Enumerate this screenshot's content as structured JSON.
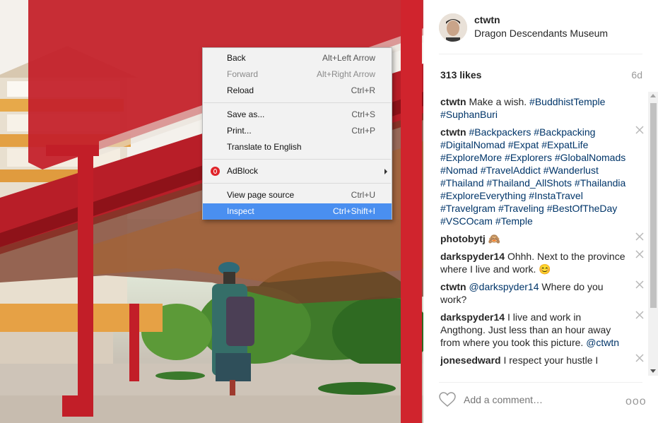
{
  "post": {
    "username": "ctwtn",
    "location": "Dragon Descendants Museum",
    "likes": "313 likes",
    "age": "6d"
  },
  "comments": [
    {
      "user": "ctwtn",
      "parts": [
        {
          "t": "Make a wish. "
        },
        {
          "t": "#BuddhistTemple",
          "tag": true
        },
        {
          "t": " "
        },
        {
          "t": "#SuphanBuri",
          "tag": true
        }
      ],
      "removable": false
    },
    {
      "user": "ctwtn",
      "parts": [
        {
          "t": "#Backpackers",
          "tag": true
        },
        {
          "t": " "
        },
        {
          "t": "#Backpacking",
          "tag": true
        },
        {
          "t": " "
        },
        {
          "t": "#DigitalNomad",
          "tag": true
        },
        {
          "t": " "
        },
        {
          "t": "#Expat",
          "tag": true
        },
        {
          "t": " "
        },
        {
          "t": "#ExpatLife",
          "tag": true
        },
        {
          "t": " "
        },
        {
          "t": "#ExploreMore",
          "tag": true
        },
        {
          "t": " "
        },
        {
          "t": "#Explorers",
          "tag": true
        },
        {
          "t": " "
        },
        {
          "t": "#GlobalNomads",
          "tag": true
        },
        {
          "t": " "
        },
        {
          "t": "#Nomad",
          "tag": true
        },
        {
          "t": " "
        },
        {
          "t": "#TravelAddict",
          "tag": true
        },
        {
          "t": " "
        },
        {
          "t": "#Wanderlust",
          "tag": true
        },
        {
          "t": " "
        },
        {
          "t": "#Thailand",
          "tag": true
        },
        {
          "t": " "
        },
        {
          "t": "#Thailand_AllShots",
          "tag": true
        },
        {
          "t": " "
        },
        {
          "t": "#Thailandia",
          "tag": true
        },
        {
          "t": " "
        },
        {
          "t": "#ExploreEverything",
          "tag": true
        },
        {
          "t": " "
        },
        {
          "t": "#InstaTravel",
          "tag": true
        },
        {
          "t": " "
        },
        {
          "t": "#Travelgram",
          "tag": true
        },
        {
          "t": " "
        },
        {
          "t": "#Traveling",
          "tag": true
        },
        {
          "t": " "
        },
        {
          "t": "#BestOfTheDay",
          "tag": true
        },
        {
          "t": " "
        },
        {
          "t": "#VSCOcam",
          "tag": true
        },
        {
          "t": " "
        },
        {
          "t": "#Temple",
          "tag": true
        }
      ],
      "removable": true
    },
    {
      "user": "photobytj",
      "parts": [
        {
          "t": "🙈"
        }
      ],
      "removable": true
    },
    {
      "user": "darkspyder14",
      "parts": [
        {
          "t": "Ohhh. Next to the province where I live and work. 😊"
        }
      ],
      "removable": true
    },
    {
      "user": "ctwtn",
      "parts": [
        {
          "t": "@darkspyder14",
          "tag": true
        },
        {
          "t": " Where do you work?"
        }
      ],
      "removable": true
    },
    {
      "user": "darkspyder14",
      "parts": [
        {
          "t": "I live and work in Angthong. Just less than an hour away from where you took this picture. "
        },
        {
          "t": "@ctwtn",
          "tag": true
        }
      ],
      "removable": true
    },
    {
      "user": "jonesedward",
      "parts": [
        {
          "t": "I respect your hustle I"
        }
      ],
      "removable": true
    }
  ],
  "comment_input": {
    "placeholder": "Add a comment…"
  },
  "more_label": "ooo",
  "context_menu": {
    "items": [
      {
        "label": "Back",
        "shortcut": "Alt+Left Arrow",
        "disabled": false
      },
      {
        "label": "Forward",
        "shortcut": "Alt+Right Arrow",
        "disabled": true
      },
      {
        "label": "Reload",
        "shortcut": "Ctrl+R",
        "disabled": false
      },
      {
        "separator": true
      },
      {
        "label": "Save as...",
        "shortcut": "Ctrl+S",
        "disabled": false
      },
      {
        "label": "Print...",
        "shortcut": "Ctrl+P",
        "disabled": false
      },
      {
        "label": "Translate to English",
        "shortcut": "",
        "disabled": false
      },
      {
        "separator": true
      },
      {
        "label": "AdBlock",
        "shortcut": "",
        "icon": "adblock-icon",
        "submenu": true
      },
      {
        "separator": true
      },
      {
        "label": "View page source",
        "shortcut": "Ctrl+U",
        "disabled": false
      },
      {
        "label": "Inspect",
        "shortcut": "Ctrl+Shift+I",
        "highlighted": true
      }
    ]
  },
  "colors": {
    "accent": "#4a8ff0",
    "hashtag": "#003569",
    "temple_red": "#c4222b"
  },
  "icons": {
    "heart": "heart-icon",
    "close": "close-icon",
    "adblock": "adblock-icon"
  }
}
